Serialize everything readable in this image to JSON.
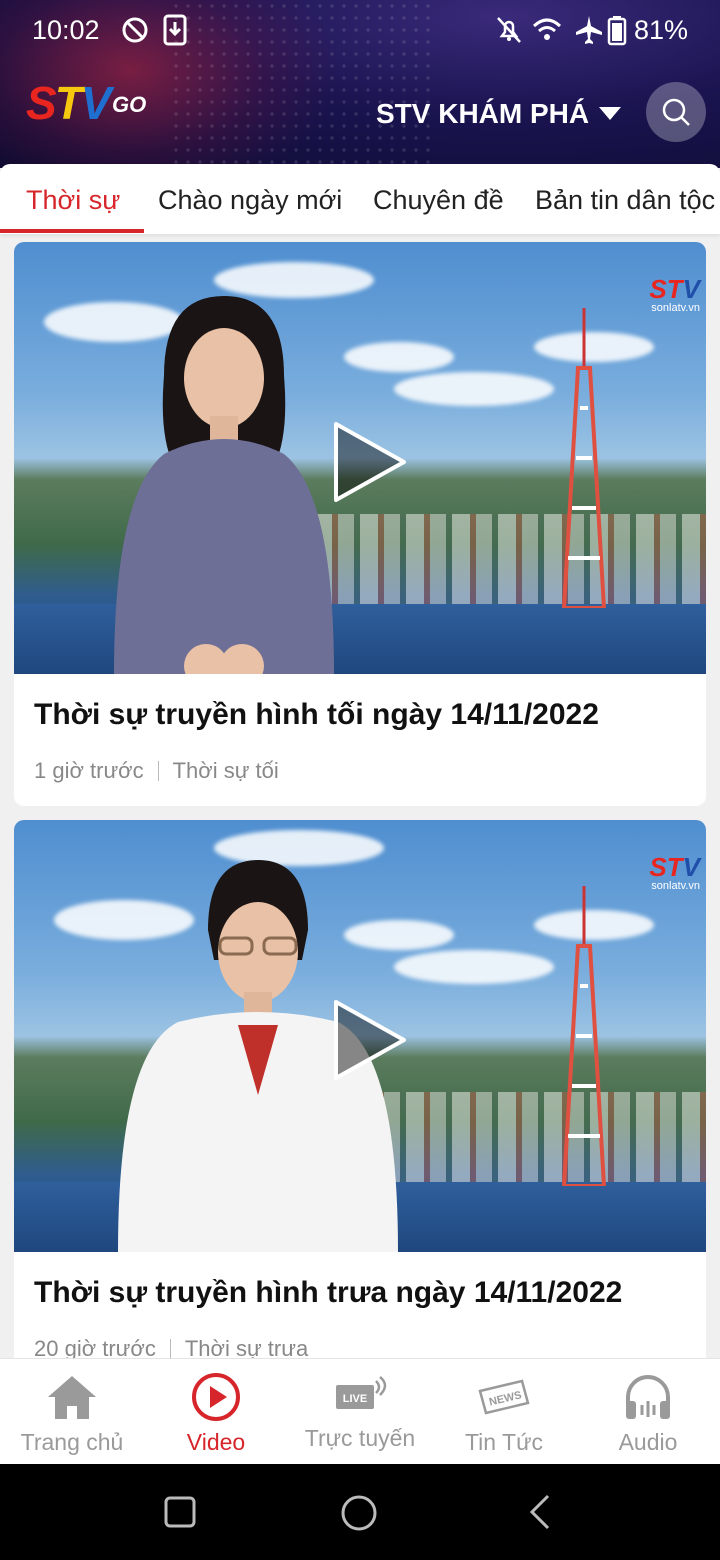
{
  "status_bar": {
    "time": "10:02",
    "battery": "81%",
    "icons": [
      "dnd-icon",
      "download-icon",
      "mute-icon",
      "wifi-icon",
      "airplane-icon",
      "battery-icon"
    ]
  },
  "header": {
    "logo": {
      "s": "S",
      "t": "T",
      "v": "V",
      "go": "GO"
    },
    "channel": "STV KHÁM PHÁ"
  },
  "tabs": [
    {
      "label": "Thời sự",
      "active": true
    },
    {
      "label": "Chào ngày mới"
    },
    {
      "label": "Chuyên đề"
    },
    {
      "label": "Bản tin dân tộc"
    }
  ],
  "watermark": {
    "s": "S",
    "t": "T",
    "v": "V",
    "site": "sonlatv.vn"
  },
  "videos": [
    {
      "title": "Thời sự truyền hình tối ngày 14/11/2022",
      "time_ago": "1 giờ trước",
      "category": "Thời sự tối"
    },
    {
      "title": "Thời sự truyền hình trưa ngày 14/11/2022",
      "time_ago": "20 giờ trước",
      "category": "Thời sự trưa"
    }
  ],
  "bottom_nav": [
    {
      "label": "Trang chủ",
      "icon": "home-icon"
    },
    {
      "label": "Video",
      "icon": "play-circle-icon",
      "active": true
    },
    {
      "label": "Trực tuyến",
      "icon": "live-icon",
      "badge": "LIVE"
    },
    {
      "label": "Tin Tức",
      "icon": "news-icon",
      "badge": "NEWS"
    },
    {
      "label": "Audio",
      "icon": "headphones-icon"
    }
  ],
  "colors": {
    "accent": "#d7262b",
    "header_bg": "#1a1450",
    "inactive": "#9a9a9a"
  }
}
